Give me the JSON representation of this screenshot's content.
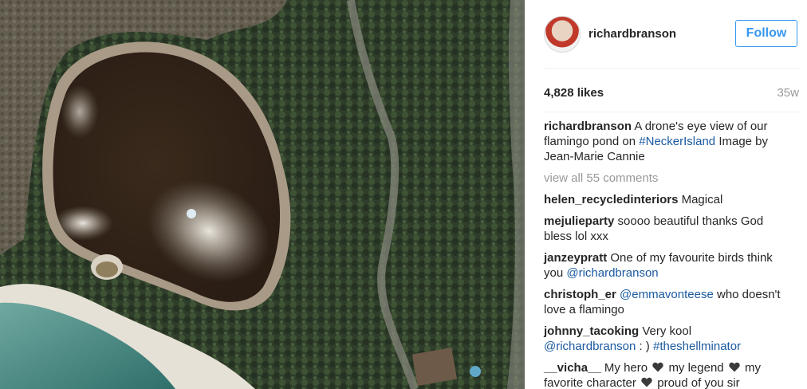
{
  "post": {
    "username": "richardbranson",
    "follow_label": "Follow",
    "likes": "4,828 likes",
    "age": "35w"
  },
  "caption": {
    "user": "richardbranson",
    "text1": "A drone's eye view of our flamingo pond on",
    "hashtag": "#NeckerIsland",
    "text2": "Image by Jean-Marie Cannie"
  },
  "view_all": "view all 55 comments",
  "comments": [
    {
      "user": "helen_recycledinteriors",
      "text": "Magical"
    },
    {
      "user": "mejulieparty",
      "text": "soooo beautiful thanks God bless lol xxx"
    },
    {
      "user": "janzeypratt",
      "text": "One of my favourite birds think you",
      "mention": "@richardbranson"
    },
    {
      "user": "christoph_er",
      "mention": "@emmavonteese",
      "text": "who doesn't love a flamingo"
    },
    {
      "user": "johnny_tacoking",
      "text": "Very kool",
      "mention": "@richardbranson",
      "mid": ": )",
      "hashtag": "#theshellminator"
    },
    {
      "user": "__vicha__",
      "p1": "My hero",
      "p2": "my legend",
      "p3": "my favorite character",
      "p4": "proud of you sir"
    }
  ],
  "icons": {
    "avatar": "profile-photo",
    "heart": "black-heart-icon"
  },
  "colors": {
    "follow": "#3897f0",
    "link": "#1b5aa1",
    "muted": "#999999",
    "text": "#262626"
  }
}
